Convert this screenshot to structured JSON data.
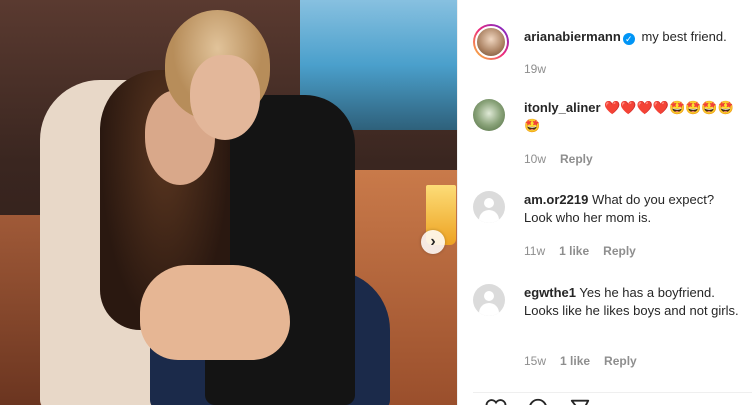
{
  "post": {
    "author": "arianabiermann",
    "caption": "my best friend.",
    "time": "19w"
  },
  "comments": [
    {
      "user": "itonly_aliner",
      "text": "❤️❤️❤️❤️🤩🤩🤩🤩🤩",
      "time": "10w",
      "likes": "",
      "reply": "Reply"
    },
    {
      "user": "am.or2219",
      "text": "What do you expect? Look who her mom is.",
      "time": "11w",
      "likes": "1 like",
      "reply": "Reply"
    },
    {
      "user": "egwthe1",
      "text": "Yes he has a boyfriend. Looks like he likes boys and not girls.",
      "time": "15w",
      "likes": "1 like",
      "reply": "Reply"
    }
  ],
  "icons": {
    "next": "chevron-right-icon",
    "verified": "verified-badge-icon",
    "like": "heart-icon",
    "comment": "comment-icon",
    "share": "paper-plane-icon"
  },
  "colors": {
    "verified": "#0095f6",
    "meta": "#8e8e8e",
    "text": "#262626"
  }
}
